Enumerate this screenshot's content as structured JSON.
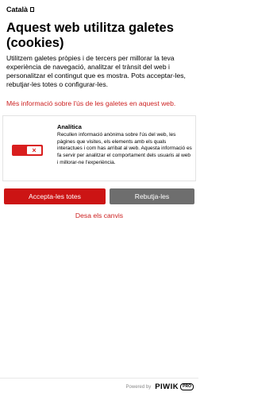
{
  "language": {
    "label": "Català",
    "icon": "dropdown-box-icon"
  },
  "title": "Aquest web utilitza galetes (cookies)",
  "intro": "Utilitzem galetes pròpies i de tercers per millorar la teva experiència de navegació, analitzar el trànsit del web i personalitzar el contingut que es mostra. Pots acceptar-les, rebutjar-les totes o configurar-les.",
  "more_info_link": "Més informació sobre l'ús de les galetes en aquest web.",
  "categories": [
    {
      "title": "Analítica",
      "description": "Recullen informació anònima sobre l'ús del web, les pàgines que visites, els elements amb els quals interactues i com has arribat al web. Aquesta informació es fa servir per analitzar el comportament dels usuaris al web i millorar-ne l'experiència.",
      "toggle_symbol": "×",
      "enabled": false
    }
  ],
  "buttons": {
    "accept_all": "Accepta-les totes",
    "reject_all": "Rebutja-les"
  },
  "save_link": "Desa els canvis",
  "footer": {
    "powered_by": "Powered by",
    "brand": "PIWIK",
    "brand_badge": "PRO"
  },
  "colors": {
    "accent_red": "#cc1414",
    "reject_grey": "#6e6e6e",
    "link_red": "#cc1f1f"
  }
}
